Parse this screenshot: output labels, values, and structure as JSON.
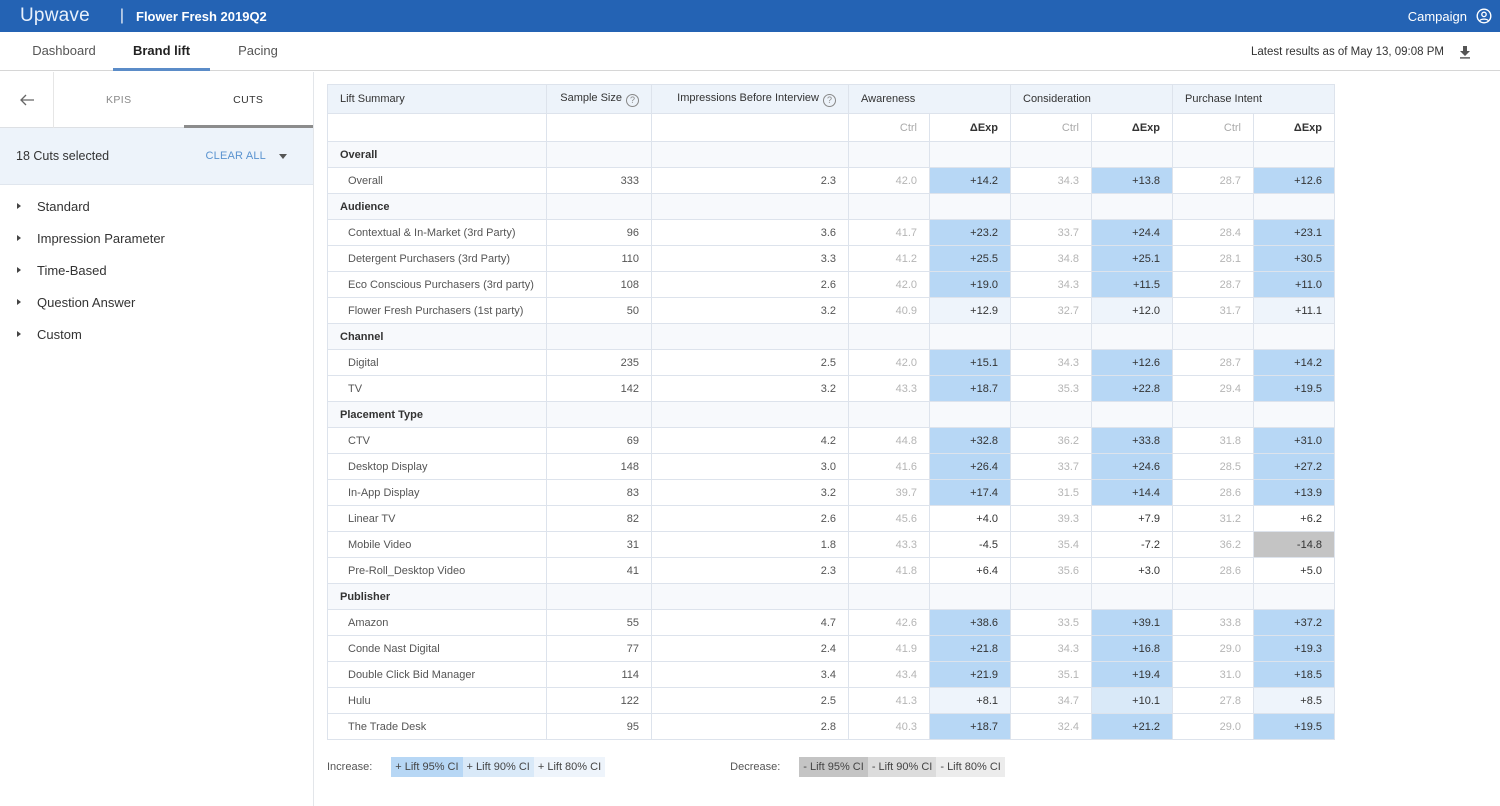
{
  "app": {
    "logo": "Upwave",
    "separator": "|",
    "campaign_title": "Flower Fresh 2019Q2",
    "account_label": "Campaign",
    "account_icon": "user-circle-icon"
  },
  "nav": {
    "tabs": [
      {
        "label": "Dashboard",
        "active": false
      },
      {
        "label": "Brand lift",
        "active": true
      },
      {
        "label": "Pacing",
        "active": false
      }
    ],
    "latest_results": "Latest results as of May 13, 09:08 PM",
    "download_icon": "download-icon"
  },
  "sidebar": {
    "back_icon": "arrow-left-icon",
    "tabs": [
      {
        "label": "KPIS",
        "active": false
      },
      {
        "label": "CUTS",
        "active": true
      }
    ],
    "cuts_selected": "18 Cuts selected",
    "clear_all": "CLEAR ALL",
    "tree": [
      {
        "label": "Standard"
      },
      {
        "label": "Impression Parameter"
      },
      {
        "label": "Time-Based"
      },
      {
        "label": "Question Answer"
      },
      {
        "label": "Custom"
      }
    ]
  },
  "table": {
    "headers": {
      "lift_summary": "Lift Summary",
      "sample_size": "Sample Size",
      "impressions": "Impressions Before Interview",
      "help_glyph": "?",
      "metrics": [
        "Awareness",
        "Consideration",
        "Purchase Intent"
      ],
      "ctrl": "Ctrl",
      "exp": "ΔExp"
    },
    "groups": [
      {
        "name": "Overall",
        "rows": [
          {
            "label": "Overall",
            "sample": "333",
            "impr": "2.3",
            "cells": [
              [
                "42.0",
                "+14.2",
                "b95"
              ],
              [
                "34.3",
                "+13.8",
                "b95"
              ],
              [
                "28.7",
                "+12.6",
                "b95"
              ]
            ]
          }
        ]
      },
      {
        "name": "Audience",
        "rows": [
          {
            "label": "Contextual & In-Market (3rd Party)",
            "sample": "96",
            "impr": "3.6",
            "cells": [
              [
                "41.7",
                "+23.2",
                "b95"
              ],
              [
                "33.7",
                "+24.4",
                "b95"
              ],
              [
                "28.4",
                "+23.1",
                "b95"
              ]
            ]
          },
          {
            "label": "Detergent Purchasers (3rd Party)",
            "sample": "110",
            "impr": "3.3",
            "cells": [
              [
                "41.2",
                "+25.5",
                "b95"
              ],
              [
                "34.8",
                "+25.1",
                "b95"
              ],
              [
                "28.1",
                "+30.5",
                "b95"
              ]
            ]
          },
          {
            "label": "Eco Conscious Purchasers (3rd party)",
            "sample": "108",
            "impr": "2.6",
            "cells": [
              [
                "42.0",
                "+19.0",
                "b95"
              ],
              [
                "34.3",
                "+11.5",
                "b95"
              ],
              [
                "28.7",
                "+11.0",
                "b95"
              ]
            ]
          },
          {
            "label": "Flower Fresh Purchasers (1st party)",
            "sample": "50",
            "impr": "3.2",
            "cells": [
              [
                "40.9",
                "+12.9",
                "b80"
              ],
              [
                "32.7",
                "+12.0",
                "b80"
              ],
              [
                "31.7",
                "+11.1",
                "b80"
              ]
            ]
          }
        ]
      },
      {
        "name": "Channel",
        "rows": [
          {
            "label": "Digital",
            "sample": "235",
            "impr": "2.5",
            "cells": [
              [
                "42.0",
                "+15.1",
                "b95"
              ],
              [
                "34.3",
                "+12.6",
                "b95"
              ],
              [
                "28.7",
                "+14.2",
                "b95"
              ]
            ]
          },
          {
            "label": "TV",
            "sample": "142",
            "impr": "3.2",
            "cells": [
              [
                "43.3",
                "+18.7",
                "b95"
              ],
              [
                "35.3",
                "+22.8",
                "b95"
              ],
              [
                "29.4",
                "+19.5",
                "b95"
              ]
            ]
          }
        ]
      },
      {
        "name": "Placement Type",
        "rows": [
          {
            "label": "CTV",
            "sample": "69",
            "impr": "4.2",
            "cells": [
              [
                "44.8",
                "+32.8",
                "b95"
              ],
              [
                "36.2",
                "+33.8",
                "b95"
              ],
              [
                "31.8",
                "+31.0",
                "b95"
              ]
            ]
          },
          {
            "label": "Desktop Display",
            "sample": "148",
            "impr": "3.0",
            "cells": [
              [
                "41.6",
                "+26.4",
                "b95"
              ],
              [
                "33.7",
                "+24.6",
                "b95"
              ],
              [
                "28.5",
                "+27.2",
                "b95"
              ]
            ]
          },
          {
            "label": "In-App Display",
            "sample": "83",
            "impr": "3.2",
            "cells": [
              [
                "39.7",
                "+17.4",
                "b95"
              ],
              [
                "31.5",
                "+14.4",
                "b95"
              ],
              [
                "28.6",
                "+13.9",
                "b95"
              ]
            ]
          },
          {
            "label": "Linear TV",
            "sample": "82",
            "impr": "2.6",
            "cells": [
              [
                "45.6",
                "+4.0",
                ""
              ],
              [
                "39.3",
                "+7.9",
                ""
              ],
              [
                "31.2",
                "+6.2",
                ""
              ]
            ]
          },
          {
            "label": "Mobile Video",
            "sample": "31",
            "impr": "1.8",
            "cells": [
              [
                "43.3",
                "-4.5",
                ""
              ],
              [
                "35.4",
                "-7.2",
                ""
              ],
              [
                "36.2",
                "-14.8",
                "d95"
              ]
            ]
          },
          {
            "label": "Pre-Roll_Desktop Video",
            "sample": "41",
            "impr": "2.3",
            "cells": [
              [
                "41.8",
                "+6.4",
                ""
              ],
              [
                "35.6",
                "+3.0",
                ""
              ],
              [
                "28.6",
                "+5.0",
                ""
              ]
            ]
          }
        ]
      },
      {
        "name": "Publisher",
        "rows": [
          {
            "label": "Amazon",
            "sample": "55",
            "impr": "4.7",
            "cells": [
              [
                "42.6",
                "+38.6",
                "b95"
              ],
              [
                "33.5",
                "+39.1",
                "b95"
              ],
              [
                "33.8",
                "+37.2",
                "b95"
              ]
            ]
          },
          {
            "label": "Conde Nast Digital",
            "sample": "77",
            "impr": "2.4",
            "cells": [
              [
                "41.9",
                "+21.8",
                "b95"
              ],
              [
                "34.3",
                "+16.8",
                "b95"
              ],
              [
                "29.0",
                "+19.3",
                "b95"
              ]
            ]
          },
          {
            "label": "Double Click Bid Manager",
            "sample": "114",
            "impr": "3.4",
            "cells": [
              [
                "43.4",
                "+21.9",
                "b95"
              ],
              [
                "35.1",
                "+19.4",
                "b95"
              ],
              [
                "31.0",
                "+18.5",
                "b95"
              ]
            ]
          },
          {
            "label": "Hulu",
            "sample": "122",
            "impr": "2.5",
            "cells": [
              [
                "41.3",
                "+8.1",
                "b80"
              ],
              [
                "34.7",
                "+10.1",
                "b90"
              ],
              [
                "27.8",
                "+8.5",
                "b80"
              ]
            ]
          },
          {
            "label": "The Trade Desk",
            "sample": "95",
            "impr": "2.8",
            "cells": [
              [
                "40.3",
                "+18.7",
                "b95"
              ],
              [
                "32.4",
                "+21.2",
                "b95"
              ],
              [
                "29.0",
                "+19.5",
                "b95"
              ]
            ]
          }
        ]
      }
    ]
  },
  "legend": {
    "increase_label": "Increase:",
    "increase": [
      {
        "label": "+ Lift 95% CI",
        "level": "b95"
      },
      {
        "label": "+ Lift 90% CI",
        "level": "b90"
      },
      {
        "label": "+ Lift 80% CI",
        "level": "b80"
      }
    ],
    "decrease_label": "Decrease:",
    "decrease": [
      {
        "label": "- Lift 95% CI",
        "level": "d95"
      },
      {
        "label": "- Lift 90% CI",
        "level": "d90"
      },
      {
        "label": "- Lift 80% CI",
        "level": "d80"
      }
    ]
  },
  "colors": {
    "brand_blue": "#2463b4",
    "lift_95": "#b7d7f5",
    "lift_90": "#d9e9f8",
    "lift_80": "#eef4fb",
    "drop_95": "#c4c4c4",
    "drop_90": "#dcdcdc",
    "drop_80": "#ececec",
    "link": "#5a93d0"
  }
}
